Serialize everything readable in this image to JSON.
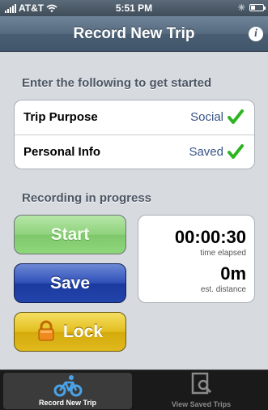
{
  "status_bar": {
    "carrier": "AT&T",
    "time": "5:51 PM",
    "bluetooth_icon": "bluetooth-icon",
    "battery_icon": "battery-icon"
  },
  "nav_bar": {
    "title": "Record New Trip",
    "info_icon": "info-icon",
    "info_glyph": "i"
  },
  "setup_section": {
    "header": "Enter the following to get started",
    "rows": [
      {
        "label": "Trip Purpose",
        "value": "Social",
        "icon": "checkmark-icon"
      },
      {
        "label": "Personal Info",
        "value": "Saved",
        "icon": "checkmark-icon"
      }
    ]
  },
  "recording_section": {
    "header": "Recording in progress",
    "buttons": {
      "start": "Start",
      "save": "Save",
      "lock": "Lock",
      "lock_icon": "padlock-icon"
    },
    "timer": {
      "elapsed": "00:00:30",
      "elapsed_label": "time elapsed",
      "distance": "0m",
      "distance_label": "est. distance"
    }
  },
  "tab_bar": {
    "tabs": [
      {
        "label": "Record New Trip",
        "icon": "bicycle-icon",
        "selected": true
      },
      {
        "label": "View Saved Trips",
        "icon": "magnifier-document-icon",
        "selected": false
      }
    ]
  },
  "colors": {
    "check_green": "#2fb521",
    "value_blue": "#385487",
    "start_green": "#8fd27b",
    "save_blue": "#2244ab",
    "lock_gold": "#e0b91d",
    "tab_active_blue": "#4aa3e8"
  }
}
